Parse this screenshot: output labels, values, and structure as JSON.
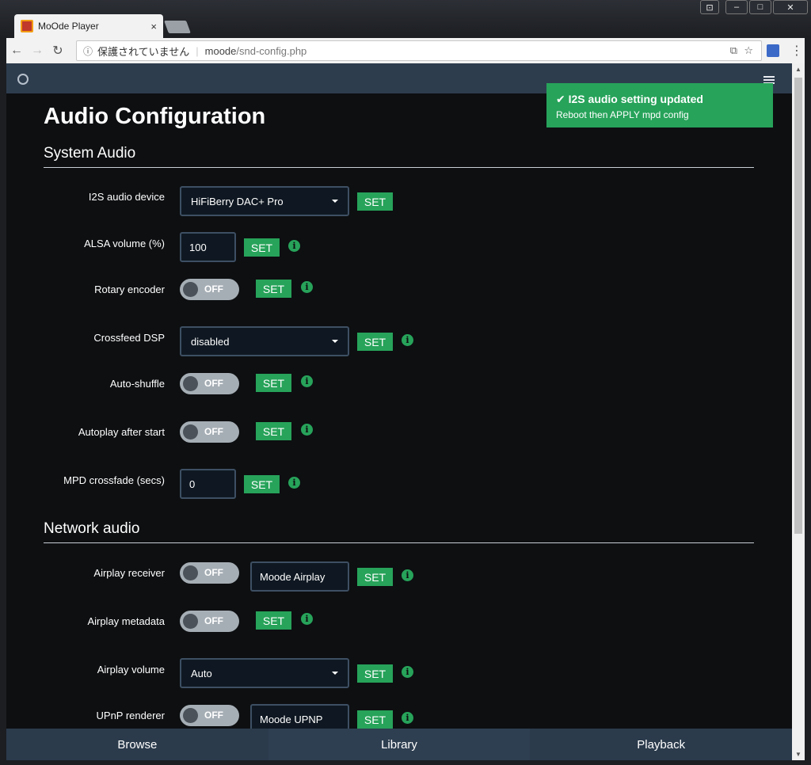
{
  "browser": {
    "tab_title": "MoOde Player",
    "tab_close": "×",
    "address_security": "保護されていません",
    "address_host": "moode",
    "address_path": "/snd-config.php"
  },
  "notification": {
    "title": "I2S audio setting updated",
    "message": "Reboot then APPLY mpd config"
  },
  "page_title": "Audio Configuration",
  "sections": {
    "system_audio": "System Audio",
    "network_audio": "Network audio"
  },
  "set_label": "SET",
  "toggle_off": "OFF",
  "rows": {
    "i2s": {
      "label": "I2S audio device",
      "value": "HiFiBerry DAC+ Pro"
    },
    "alsa": {
      "label": "ALSA volume (%)",
      "value": "100"
    },
    "rotary": {
      "label": "Rotary encoder"
    },
    "crossfeed": {
      "label": "Crossfeed DSP",
      "value": "disabled"
    },
    "shuffle": {
      "label": "Auto-shuffle"
    },
    "autoplay": {
      "label": "Autoplay after start"
    },
    "crossfade": {
      "label": "MPD crossfade (secs)",
      "value": "0"
    },
    "airplay": {
      "label": "Airplay receiver",
      "name": "Moode Airplay"
    },
    "airplay_meta": {
      "label": "Airplay metadata"
    },
    "airplay_vol": {
      "label": "Airplay volume",
      "value": "Auto"
    },
    "upnp": {
      "label": "UPnP renderer",
      "name": "Moode UPNP"
    }
  },
  "bottom_nav": [
    "Browse",
    "Library",
    "Playback"
  ],
  "colors": {
    "accent": "#27a35a",
    "header": "#2e3d4e",
    "background": "#0d0f11"
  }
}
